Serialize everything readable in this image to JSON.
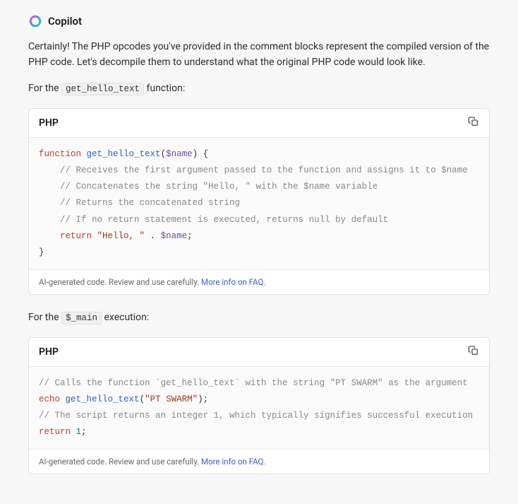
{
  "header": {
    "title": "Copilot"
  },
  "intro": {
    "p1": "Certainly! The PHP opcodes you've provided in the comment blocks represent the compiled version of the PHP code. Let's decompile them to understand what the original PHP code would look like.",
    "p2_prefix": "For the ",
    "p2_code": "get_hello_text",
    "p2_suffix": " function:"
  },
  "block1": {
    "lang": "PHP",
    "kw_function": "function",
    "fn_name": "get_hello_text",
    "open_paren": "(",
    "param": "$name",
    "close_paren_brace": ") {",
    "c1": "// Receives the first argument passed to the function and assigns it to $name",
    "c2": "// Concatenates the string \"Hello, \" with the $name variable",
    "c3": "// Returns the concatenated string",
    "c4": "// If no return statement is executed, returns null by default",
    "kw_return": "return",
    "str_hello": "\"Hello, \"",
    "concat": " . ",
    "ret_var": "$name",
    "semi": ";",
    "close_brace": "}",
    "footer_text": "AI-generated code. Review and use carefully. ",
    "footer_link": "More info on FAQ."
  },
  "mid": {
    "prefix": "For the ",
    "code": "$_main",
    "suffix": " execution:"
  },
  "block2": {
    "lang": "PHP",
    "c1": "// Calls the function `get_hello_text` with the string \"PT SWARM\" as the argument",
    "kw_echo": "echo",
    "fn_name": "get_hello_text",
    "open_paren": "(",
    "str_arg": "\"PT SWARM\"",
    "close_paren_semi": ");",
    "c2": "// The script returns an integer 1, which typically signifies successful execution",
    "kw_return": "return",
    "num_one": "1",
    "semi": ";",
    "footer_text": "AI-generated code. Review and use carefully. ",
    "footer_link": "More info on FAQ."
  }
}
